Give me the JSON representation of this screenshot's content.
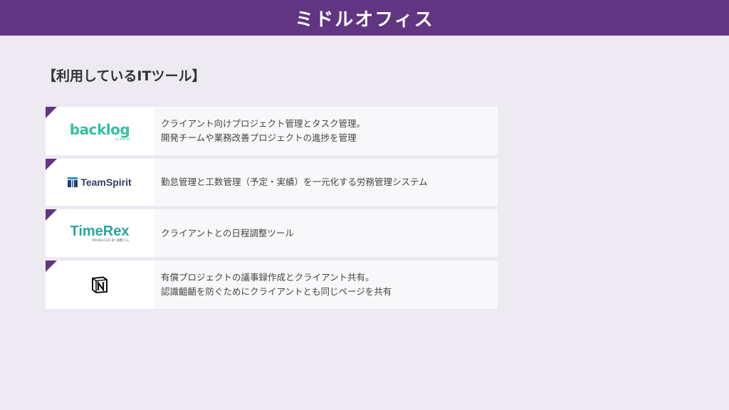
{
  "header": {
    "title": "ミドルオフィス"
  },
  "section": {
    "title": "【利用しているITツール】"
  },
  "tools": [
    {
      "logo": {
        "icon": "backlog-logo",
        "wordmark": "backlog",
        "sub": "by NULAB"
      },
      "lines": [
        "クライアント向けプロジェクト管理とタスク管理。",
        "開発チームや業務改善プロジェクトの進捗を管理"
      ]
    },
    {
      "logo": {
        "icon": "teamspirit-logo",
        "wordmark": "TeamSpirit"
      },
      "lines": [
        "勤怠管理と工数管理（予定・実績）を一元化する労務管理システム"
      ]
    },
    {
      "logo": {
        "icon": "timerex-logo",
        "wordmark": "TimeRex",
        "sub": "PRODUCED BY 調整さん"
      },
      "lines": [
        "クライアントとの日程調整ツール"
      ]
    },
    {
      "logo": {
        "icon": "notion-logo"
      },
      "lines": [
        "有償プロジェクトの議事録作成とクライアント共有。",
        "認識齟齬を防ぐためにクライアントとも同じページを共有"
      ]
    }
  ],
  "colors": {
    "header_bg": "#613582",
    "page_bg": "#eeeaf2",
    "corner_accent": "#613582",
    "backlog_green": "#34c0a0",
    "timerex_teal": "#2aa5a0",
    "teamspirit_navy": "#2c3e63"
  }
}
